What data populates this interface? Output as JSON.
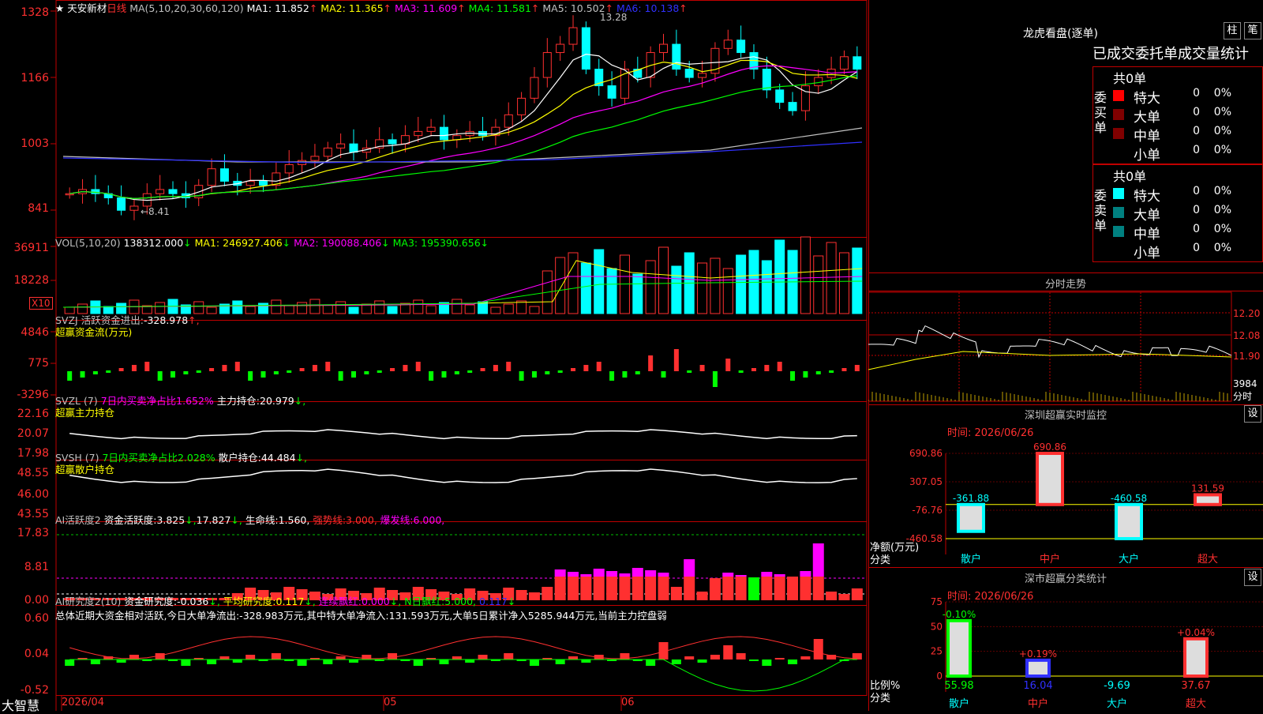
{
  "app": {
    "brand": "大智慧",
    "date_label": "2026/04"
  },
  "stock": {
    "name": "天安新材",
    "period": "日线",
    "star": "★"
  },
  "colors": {
    "up": "#ff3030",
    "down": "#00ffff",
    "bg": "#000000",
    "grid": "#c00000",
    "ma1": "#ffffff",
    "ma2": "#ffff00",
    "ma3": "#ff00ff",
    "ma4": "#00ff00",
    "ma5": "#c0c0c0",
    "ma6": "#3030ff",
    "magenta": "#ff00ff",
    "yellow": "#ffff00",
    "green": "#00ff00"
  },
  "main": {
    "ma_label": "MA(5,10,20,30,60,120)",
    "ma": [
      {
        "k": "MA1:",
        "v": "11.852",
        "a": "↑",
        "c": "ma1"
      },
      {
        "k": "MA2:",
        "v": "11.365",
        "a": "↑",
        "c": "ma2"
      },
      {
        "k": "MA3:",
        "v": "11.609",
        "a": "↑",
        "c": "ma3"
      },
      {
        "k": "MA4:",
        "v": "11.581",
        "a": "↑",
        "c": "ma4"
      },
      {
        "k": "MA5:",
        "v": "10.502",
        "a": "↑",
        "c": "ma5"
      },
      {
        "k": "MA6:",
        "v": "10.138",
        "a": "↑",
        "c": "ma6"
      }
    ],
    "y_labels": [
      "1328",
      "1166",
      "1003",
      "841"
    ],
    "high_note": "13.28",
    "low_note": "←8.41"
  },
  "vol": {
    "label": "VOL(5,10,20)",
    "value": "138312.000",
    "arrow": "↓",
    "ma": [
      {
        "k": "MA1:",
        "v": "246927.406",
        "a": "↓",
        "c": "ma2"
      },
      {
        "k": "MA2:",
        "v": "190088.406",
        "a": "↓",
        "c": "ma3"
      },
      {
        "k": "MA3:",
        "v": "195390.656",
        "a": "↓",
        "c": "ma4"
      }
    ],
    "y_labels": [
      "36911",
      "18228"
    ],
    "unit": "X10"
  },
  "svzj": {
    "label": "SVZJ",
    "text1": "活跃资金进出:",
    "value": "-328.978",
    "arrow": "↑,",
    "text2": "超赢资金流(万元)",
    "y_labels": [
      "4846",
      "775",
      "-3296"
    ]
  },
  "svzl": {
    "label": "SVZL (7)",
    "t1": "7日内买卖净占比1.652%",
    "t2": "主力持仓:",
    "v2": "20.979",
    "a2": "↓,",
    "t3": "超赢主力持仓",
    "y_labels": [
      "22.16",
      "20.07",
      "17.98"
    ]
  },
  "svsh": {
    "label": "SVSH (7)",
    "t1": "7日内买卖净占比2.028%",
    "t2": "散户持仓:",
    "v2": "44.484",
    "a2": "↓,",
    "t3": "超赢散户持仓",
    "y_labels": [
      "48.55",
      "46.00",
      "43.55"
    ]
  },
  "ai1": {
    "label": "AI活跃度2",
    "t1": "资金活跃度:",
    "v1": "3.825",
    "a1": "↓,",
    "v2": "17.827",
    "a2": "↓,",
    "t3": "生命线:",
    "v3": "1.560,",
    "t4": "强势线:",
    "v4": "3.000,",
    "t5": "爆发线:",
    "v5": "6.000,",
    "y_labels": [
      "17.83",
      "8.81",
      "0.00"
    ]
  },
  "ai2": {
    "label": "AI研究度2(10)",
    "t1": "资金研究度:",
    "v1": "-0.036",
    "a1": "↓,",
    "t2": "平均研究度:",
    "v2": "0.117",
    "a2": "↓,",
    "t3": "连续飘红:",
    "v3": "0.000",
    "a3": "↓,",
    "t4": "N日飘红:",
    "v4": "5.000,",
    "v5": "0.117",
    "a5": "↓",
    "summary": "总体近期大资金相对活跃,今日大单净流出:-328.983万元,其中特大单净流入:131.593万元,大单5日累计净入5285.944万元,当前主力控盘弱",
    "y_labels": [
      "0.60",
      "0.04",
      "-0.52"
    ]
  },
  "x_axis": {
    "labels": [
      "05",
      "06"
    ]
  },
  "dragon": {
    "title": "龙虎看盘(逐单)",
    "btn1": "柱",
    "btn2": "笔",
    "header": "已成交委托单成交量统计",
    "buy": {
      "side": "委买单",
      "total": "共0单",
      "rows": [
        {
          "name": "特大",
          "v": "0",
          "p": "0%",
          "c": "#ff0000"
        },
        {
          "name": "大单",
          "v": "0",
          "p": "0%",
          "c": "#800000"
        },
        {
          "name": "中单",
          "v": "0",
          "p": "0%",
          "c": "#800000"
        },
        {
          "name": "小单",
          "v": "0",
          "p": "0%",
          "c": ""
        }
      ]
    },
    "sell": {
      "side": "委卖单",
      "total": "共0单",
      "rows": [
        {
          "name": "特大",
          "v": "0",
          "p": "0%",
          "c": "#00ffff"
        },
        {
          "name": "大单",
          "v": "0",
          "p": "0%",
          "c": "#008080"
        },
        {
          "name": "中单",
          "v": "0",
          "p": "0%",
          "c": "#008080"
        },
        {
          "name": "小单",
          "v": "0",
          "p": "0%",
          "c": ""
        }
      ]
    }
  },
  "intraday": {
    "title": "分时走势",
    "y_labels": [
      "12.20",
      "12.08",
      "11.90"
    ],
    "vol_label": "3984",
    "unit": "分时"
  },
  "sz_monitor": {
    "title": "深圳超赢实时监控",
    "btn": "设",
    "time": "时间: 2026/06/26",
    "y_labels": [
      "690.86",
      "307.05",
      "-76.76",
      "-460.58"
    ],
    "ylabel": "净额(万元)",
    "xlabel": "分类",
    "cats": [
      "散户",
      "中户",
      "大户",
      "超大"
    ],
    "values": [
      {
        "v": -361.88,
        "t": "-361.88"
      },
      {
        "v": 690.86,
        "t": "690.86"
      },
      {
        "v": -460.58,
        "t": "-460.58"
      },
      {
        "v": 131.59,
        "t": "131.59"
      }
    ]
  },
  "sz_class": {
    "title": "深市超赢分类统计",
    "btn": "设",
    "time": "时间: 2026/06/26",
    "y_labels": [
      "75",
      "50",
      "25",
      "0"
    ],
    "ylabel": "比例%",
    "xlabel": "分类",
    "cats": [
      "散户",
      "中户",
      "大户",
      "超大"
    ],
    "bars": [
      {
        "v": 55.98,
        "t": "55.98",
        "top": "-0.10%"
      },
      {
        "v": 16.04,
        "t": "16.04",
        "top": "+0.19%"
      },
      {
        "v": -9.69,
        "t": "-9.69",
        "top": ""
      },
      {
        "v": 37.67,
        "t": "37.67",
        "top": "+0.04%"
      }
    ]
  }
}
